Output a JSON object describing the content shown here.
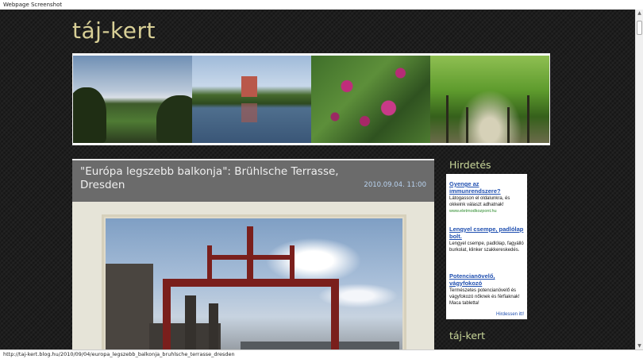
{
  "window": {
    "title": "Webpage Screenshot"
  },
  "site": {
    "title": "táj-kert"
  },
  "post": {
    "title": "\"Európa legszebb balkonja\": Brühlsche Terrasse, Dresden",
    "date": "2010.09.04. 11:00"
  },
  "sidebar": {
    "ads_heading": "Hirdetés",
    "blog_heading": "táj-kert",
    "ads": [
      {
        "title": "Gyenge az immunrendszere?",
        "text": "Látogasson el oldalunkra, és okkeink választ adhatnak!",
        "url": "www.eletmodkozpont.hu"
      },
      {
        "title": "Lengyel csempe, padlólap bolt.",
        "text": "Lengyel csempe, padlólap, fagyálló burkolat, klinker szakkereskedés.",
        "url": ""
      },
      {
        "title": "Potencianövelő, vágyfokozó",
        "text": "Természetes potencianövelő és vágyfokozó nőknek és férfiaknak! Maca tabletta!",
        "url": ""
      }
    ],
    "ads_footer": "Hirdessen itt!"
  },
  "status_bar": {
    "url": "http://taj-kert.blog.hu/2010/09/04/europa_legszebb_balkonja_bruhlsche_terrasse_dresden"
  },
  "colors": {
    "background": "#1e1e1e",
    "site_title": "#d8cf96",
    "post_header": "#6b6b6b",
    "sidebar_heading": "#c9d79a",
    "date": "#b9d3f0",
    "ad_link": "#1f4fb0"
  }
}
